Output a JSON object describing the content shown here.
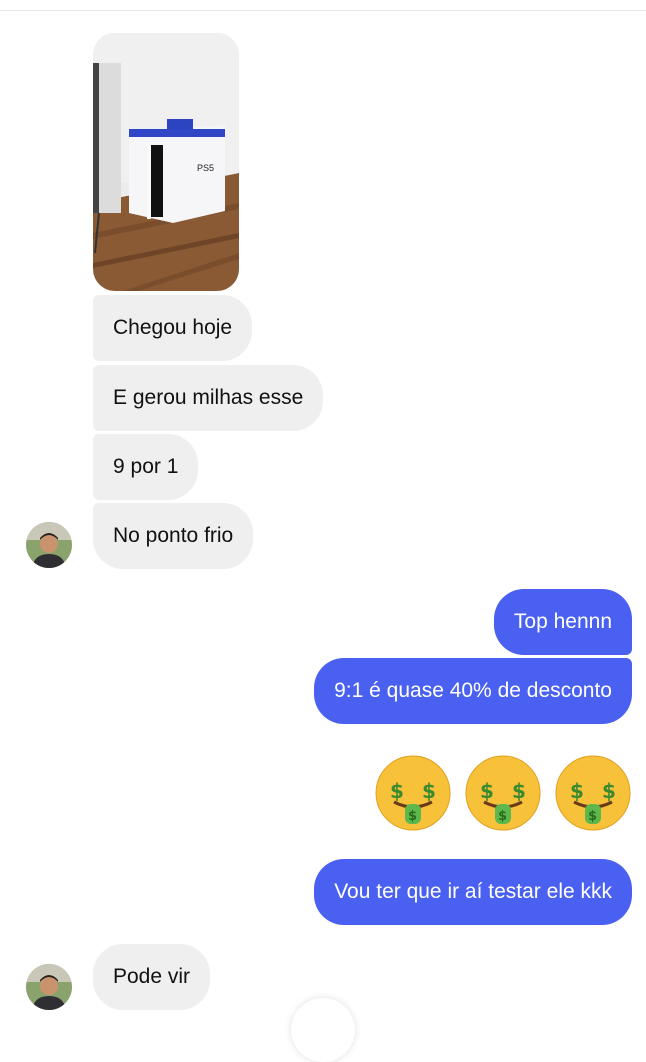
{
  "conversation": {
    "incoming": [
      {
        "text": "Chegou hoje"
      },
      {
        "text": "E gerou milhas esse"
      },
      {
        "text": "9 por 1"
      },
      {
        "text": "No ponto frio"
      },
      {
        "text": "Pode vir"
      }
    ],
    "outgoing": [
      {
        "text": "Top hennn"
      },
      {
        "text": "9:1 é quase 40% de desconto"
      },
      {
        "text": "Vou ter que ir aí testar ele kkk"
      }
    ],
    "photo": {
      "icon": "ps5-box-photo",
      "box_text": "PS5"
    },
    "emojis": [
      "money-mouth-face-icon",
      "money-mouth-face-icon",
      "money-mouth-face-icon"
    ]
  },
  "colors": {
    "incoming_bubble": "#efeff0",
    "outgoing_bubble": "#4960f1",
    "outgoing_text": "#ffffff",
    "incoming_text": "#111111"
  }
}
